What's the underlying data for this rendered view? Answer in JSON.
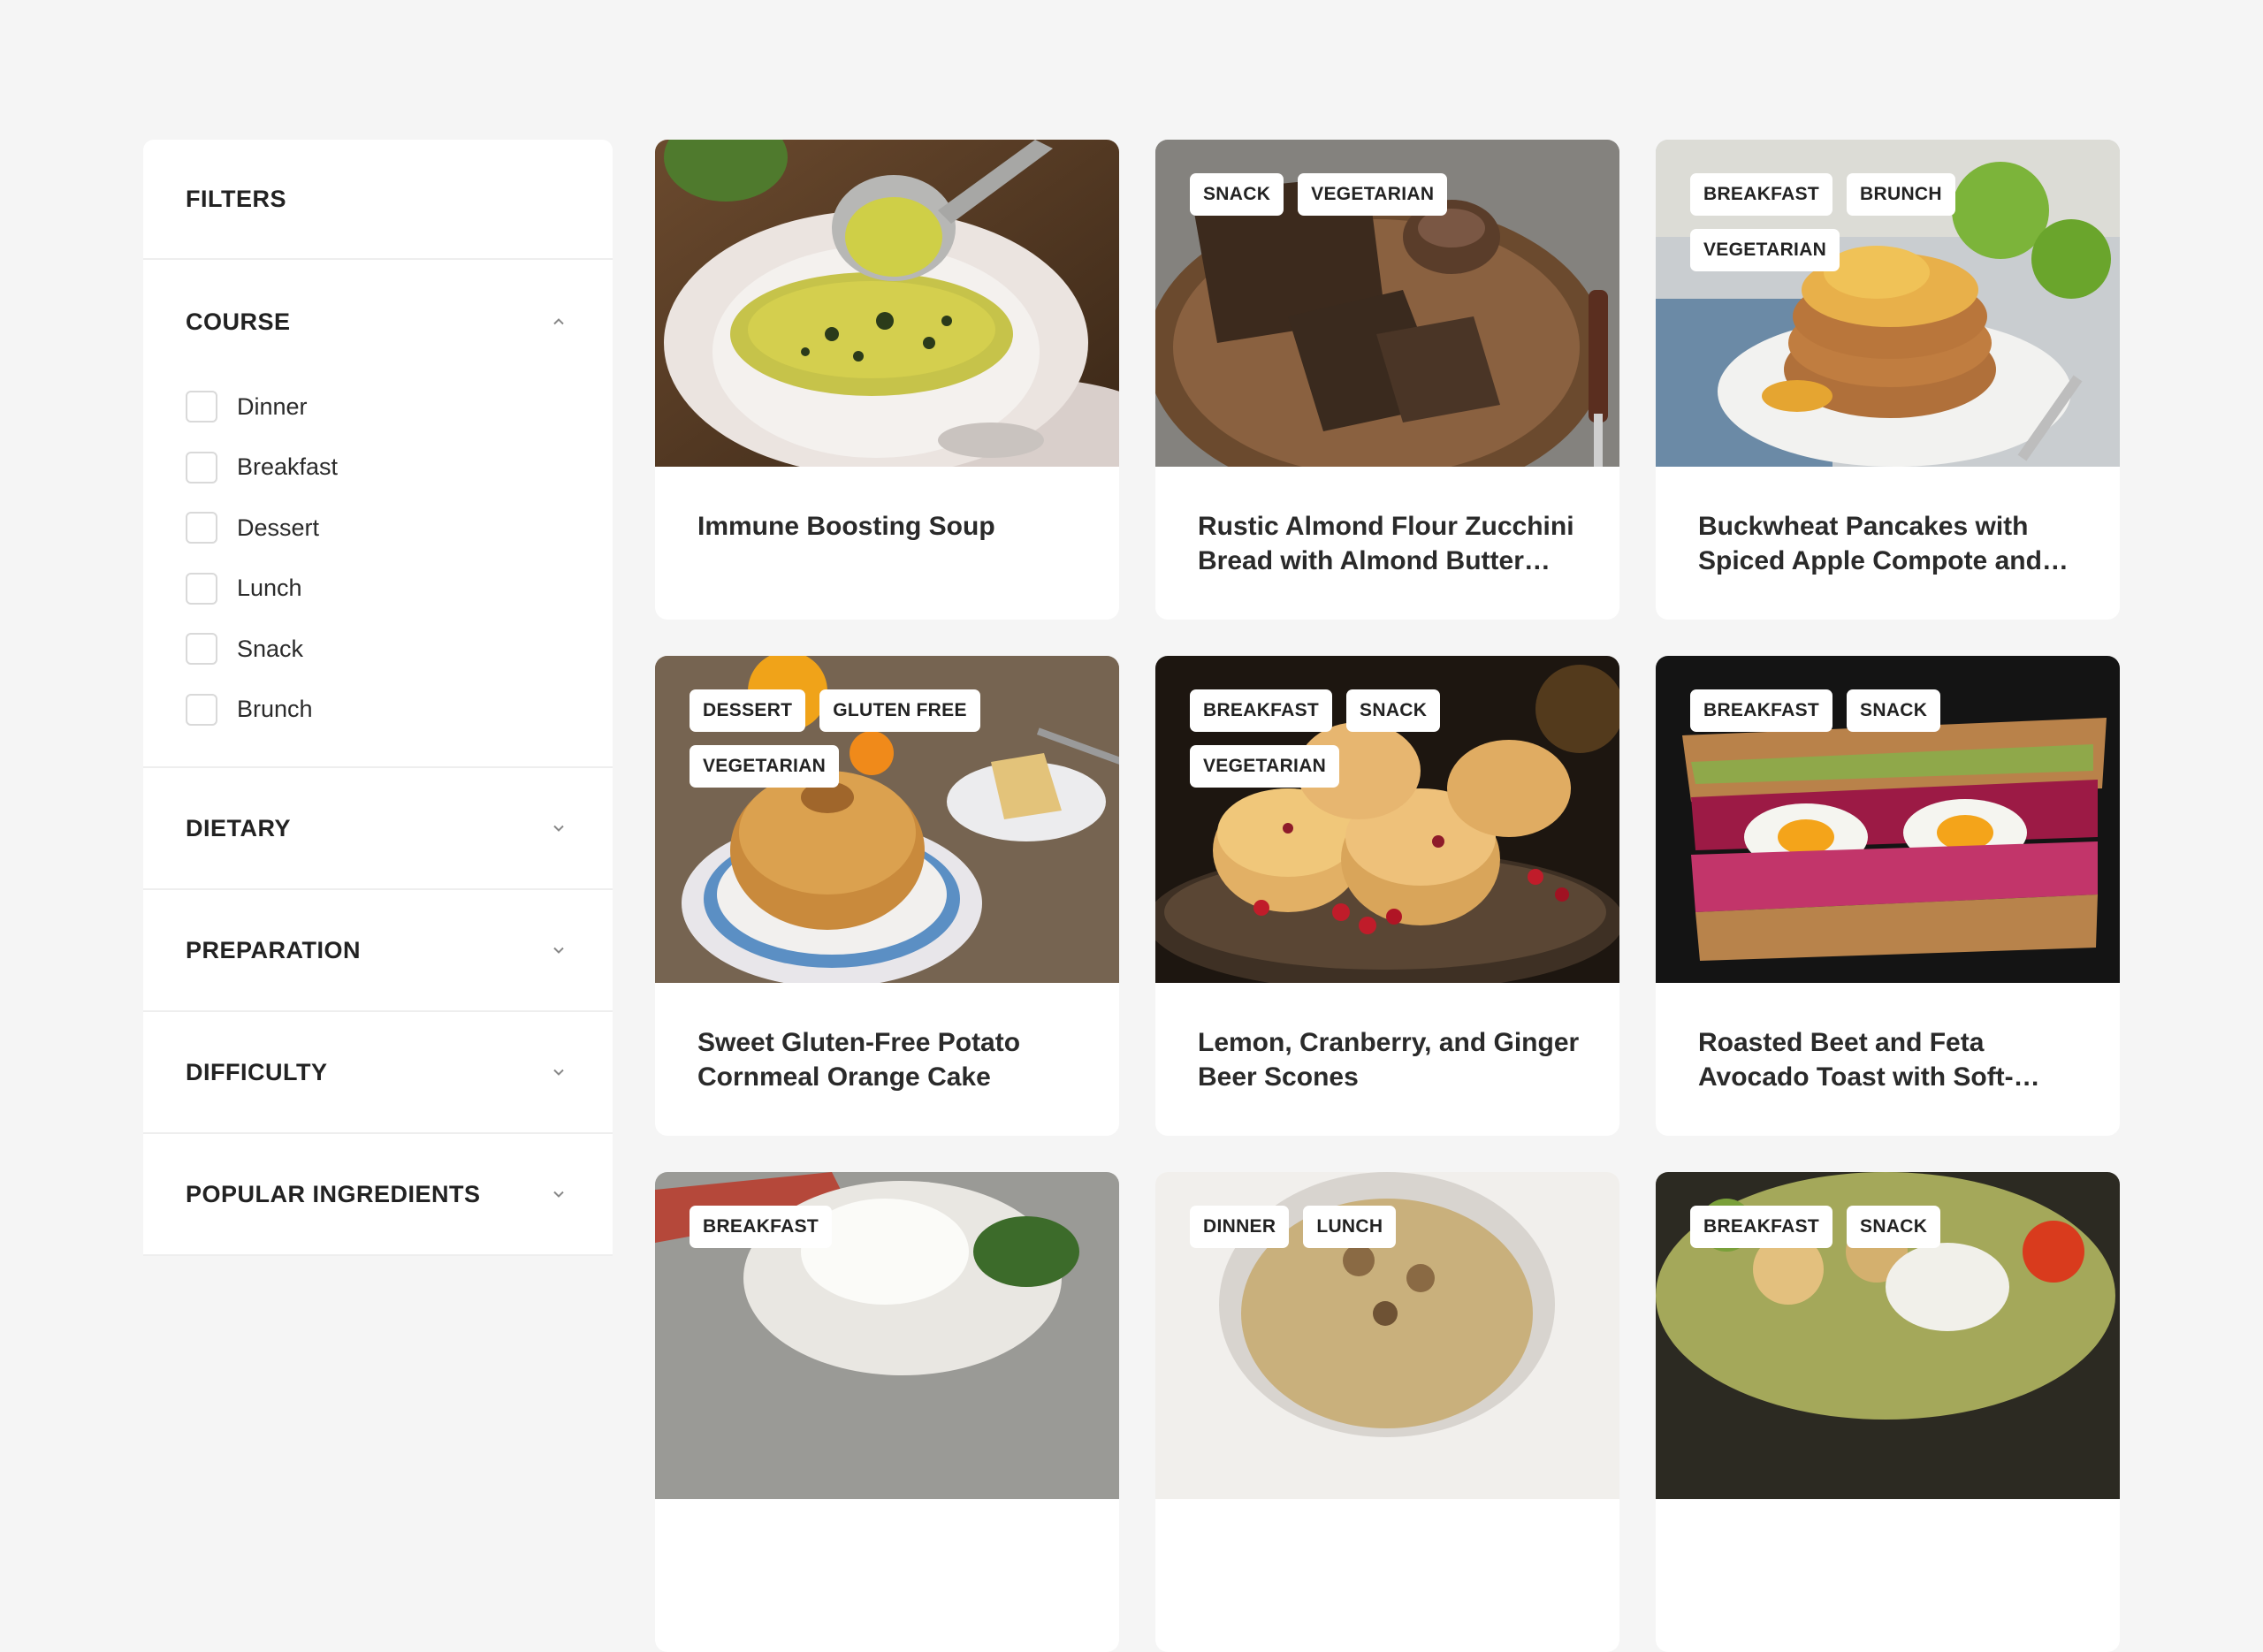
{
  "filters": {
    "title": "FILTERS",
    "course": {
      "label": "COURSE",
      "options": [
        "Dinner",
        "Breakfast",
        "Dessert",
        "Lunch",
        "Snack",
        "Brunch"
      ]
    },
    "dietary": {
      "label": "DIETARY"
    },
    "preparation": {
      "label": "PREPARATION"
    },
    "difficulty": {
      "label": "DIFFICULTY"
    },
    "popular_ingredients": {
      "label": "POPULAR INGREDIENTS"
    }
  },
  "recipes": [
    {
      "title": "Immune Boosting Soup",
      "tags": []
    },
    {
      "title": "Rustic Almond Flour Zucchini Bread with Almond Butter and…",
      "tags": [
        "SNACK",
        "VEGETARIAN"
      ]
    },
    {
      "title": "Buckwheat Pancakes with Spiced Apple Compote and…",
      "tags": [
        "BREAKFAST",
        "BRUNCH",
        "VEGETARIAN"
      ]
    },
    {
      "title": "Sweet Gluten-Free Potato Cornmeal Orange Cake",
      "tags": [
        "DESSERT",
        "GLUTEN FREE",
        "VEGETARIAN"
      ]
    },
    {
      "title": "Lemon, Cranberry, and Ginger Beer Scones",
      "tags": [
        "BREAKFAST",
        "SNACK",
        "VEGETARIAN"
      ]
    },
    {
      "title": "Roasted Beet and Feta Avocado Toast with Soft-Boiled Egg",
      "tags": [
        "BREAKFAST",
        "SNACK"
      ]
    },
    {
      "title": "",
      "tags": [
        "BREAKFAST"
      ]
    },
    {
      "title": "",
      "tags": [
        "DINNER",
        "LUNCH"
      ]
    },
    {
      "title": "",
      "tags": [
        "BREAKFAST",
        "SNACK"
      ]
    }
  ],
  "icons": {
    "expanded": "chevron-up-icon",
    "collapsed": "chevron-down-icon"
  }
}
